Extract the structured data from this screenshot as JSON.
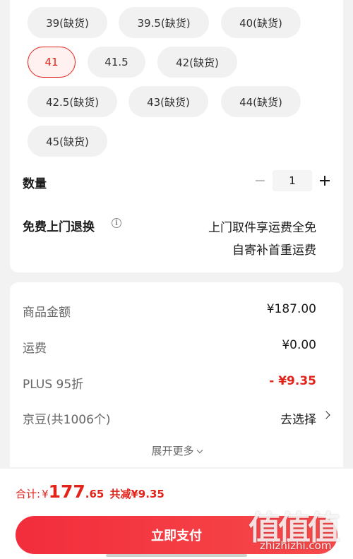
{
  "sizes": {
    "options": [
      {
        "label": "39(缺货)"
      },
      {
        "label": "39.5(缺货)"
      },
      {
        "label": "40(缺货)"
      },
      {
        "label": "41"
      },
      {
        "label": "41.5"
      },
      {
        "label": "42(缺货)"
      },
      {
        "label": "42.5(缺货)"
      },
      {
        "label": "43(缺货)"
      },
      {
        "label": "44(缺货)"
      },
      {
        "label": "45(缺货)"
      }
    ],
    "selected": "41"
  },
  "quantity": {
    "label": "数量",
    "value": "1"
  },
  "return_service": {
    "label": "免费上门退换",
    "line1": "上门取件享运费全免",
    "line2": "自寄补首重运费",
    "icon": "info-icon"
  },
  "summary": {
    "goods_label": "商品金额",
    "goods_value": "¥187.00",
    "shipping_label": "运费",
    "shipping_value": "¥0.00",
    "plus_label": "PLUS 95折",
    "plus_value": "- ¥9.35",
    "jingdou_label": "京豆(共1006个)",
    "jingdou_action": "去选择",
    "expand_label": "展开更多"
  },
  "footer": {
    "total_label": "合计:",
    "currency": "¥",
    "total_int": "177",
    "total_dec": ".65",
    "saved_label": "共减¥9.35",
    "pay_button": "立即支付"
  },
  "watermark": {
    "glyphs": "值值值",
    "site": "zhizhizhi.com"
  },
  "colors": {
    "accent": "#e2231a",
    "button": "#f22d3c",
    "background": "#f2f2f2"
  }
}
